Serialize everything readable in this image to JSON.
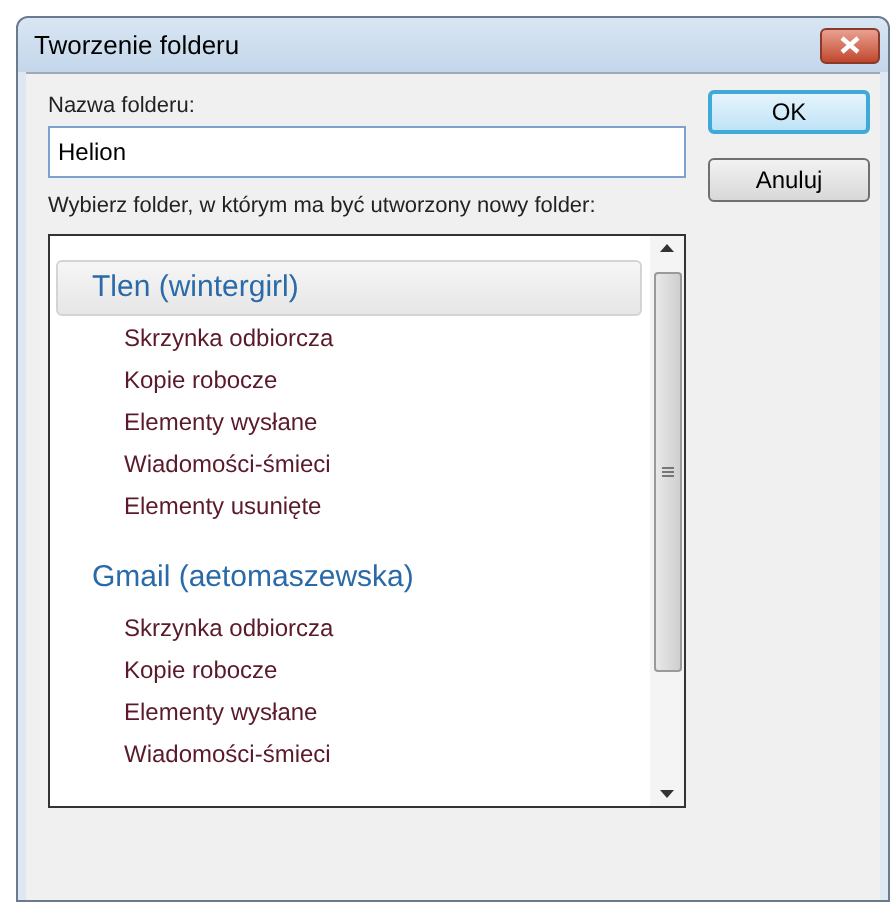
{
  "window": {
    "title": "Tworzenie folderu"
  },
  "name_label": "Nazwa folderu:",
  "name_field": {
    "value": "Helion"
  },
  "buttons": [
    {
      "label": "OK",
      "default": true
    },
    {
      "label": "Anuluj",
      "default": false
    }
  ],
  "folder_label": "Wybierz folder, w którym ma być utworzony nowy folder:",
  "accounts": [
    {
      "name": "Tlen (wintergirl)",
      "selected": true,
      "folders": [
        "Skrzynka odbiorcza",
        "Kopie robocze",
        "Elementy wysłane",
        "Wiadomości-śmieci",
        "Elementy usunięte"
      ]
    },
    {
      "name": "Gmail (aetomaszewska)",
      "selected": false,
      "folders": [
        "Skrzynka odbiorcza",
        "Kopie robocze",
        "Elementy wysłane",
        "Wiadomości-śmieci"
      ]
    }
  ]
}
